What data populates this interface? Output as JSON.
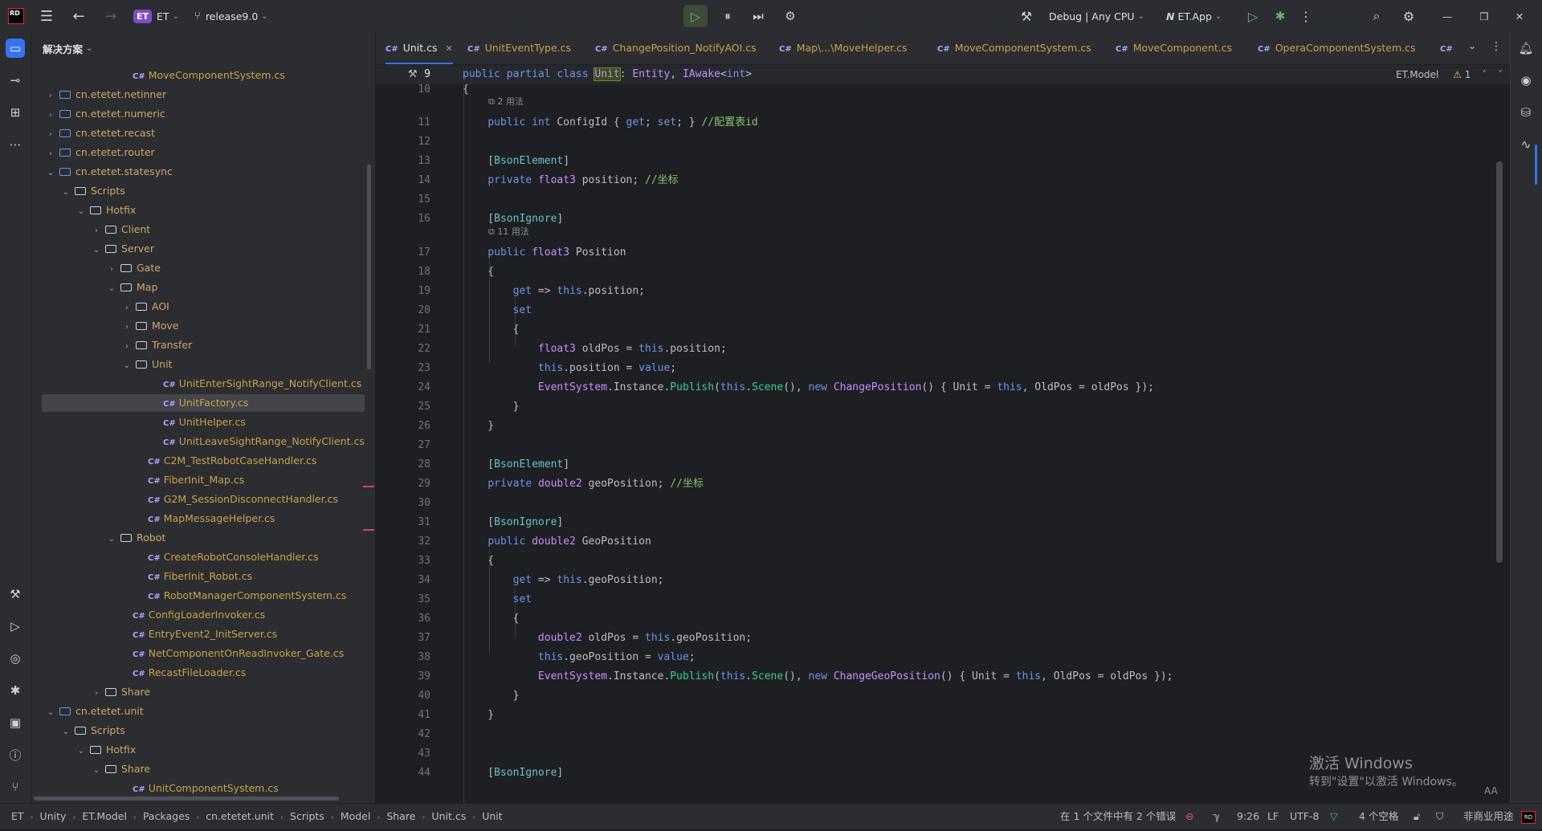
{
  "titlebar": {
    "app_logo": "RD",
    "project_badge": "ET",
    "project_name": "ET",
    "branch": "release9.0",
    "run_config": "Debug | Any CPU",
    "target": "ET.App"
  },
  "project_panel": {
    "header": "解决方案",
    "rows": [
      {
        "type": "file",
        "label": "MoveComponentSystem.cs",
        "indent": 8,
        "arrow": ""
      },
      {
        "type": "pkg",
        "label": "cn.etetet.netinner",
        "indent": 3,
        "arrow": "›"
      },
      {
        "type": "pkg",
        "label": "cn.etetet.numeric",
        "indent": 3,
        "arrow": "›"
      },
      {
        "type": "pkg",
        "label": "cn.etetet.recast",
        "indent": 3,
        "arrow": "›"
      },
      {
        "type": "pkg",
        "label": "cn.etetet.router",
        "indent": 3,
        "arrow": "›"
      },
      {
        "type": "pkg",
        "label": "cn.etetet.statesync",
        "indent": 3,
        "arrow": "⌄"
      },
      {
        "type": "folder",
        "label": "Scripts",
        "indent": 4,
        "arrow": "⌄"
      },
      {
        "type": "folder",
        "label": "Hotfix",
        "indent": 5,
        "arrow": "⌄"
      },
      {
        "type": "folder",
        "label": "Client",
        "indent": 6,
        "arrow": "›"
      },
      {
        "type": "folder",
        "label": "Server",
        "indent": 6,
        "arrow": "⌄"
      },
      {
        "type": "folder",
        "label": "Gate",
        "indent": 7,
        "arrow": "›"
      },
      {
        "type": "folder",
        "label": "Map",
        "indent": 7,
        "arrow": "⌄"
      },
      {
        "type": "folder",
        "label": "AOI",
        "indent": 8,
        "arrow": "›"
      },
      {
        "type": "folder",
        "label": "Move",
        "indent": 8,
        "arrow": "›"
      },
      {
        "type": "folder",
        "label": "Transfer",
        "indent": 8,
        "arrow": "›"
      },
      {
        "type": "folder",
        "label": "Unit",
        "indent": 8,
        "arrow": "⌄"
      },
      {
        "type": "file",
        "label": "UnitEnterSightRange_NotifyClient.cs",
        "indent": 10,
        "arrow": ""
      },
      {
        "type": "file",
        "label": "UnitFactory.cs",
        "indent": 10,
        "arrow": ""
      },
      {
        "type": "file",
        "label": "UnitHelper.cs",
        "indent": 10,
        "arrow": ""
      },
      {
        "type": "file",
        "label": "UnitLeaveSightRange_NotifyClient.cs",
        "indent": 10,
        "arrow": ""
      },
      {
        "type": "file",
        "label": "C2M_TestRobotCaseHandler.cs",
        "indent": 9,
        "arrow": ""
      },
      {
        "type": "file",
        "label": "FiberInit_Map.cs",
        "indent": 9,
        "arrow": ""
      },
      {
        "type": "file",
        "label": "G2M_SessionDisconnectHandler.cs",
        "indent": 9,
        "arrow": ""
      },
      {
        "type": "file",
        "label": "MapMessageHelper.cs",
        "indent": 9,
        "arrow": ""
      },
      {
        "type": "folder",
        "label": "Robot",
        "indent": 7,
        "arrow": "⌄"
      },
      {
        "type": "file",
        "label": "CreateRobotConsoleHandler.cs",
        "indent": 9,
        "arrow": ""
      },
      {
        "type": "file",
        "label": "FiberInit_Robot.cs",
        "indent": 9,
        "arrow": ""
      },
      {
        "type": "file",
        "label": "RobotManagerComponentSystem.cs",
        "indent": 9,
        "arrow": ""
      },
      {
        "type": "file",
        "label": "ConfigLoaderInvoker.cs",
        "indent": 8,
        "arrow": ""
      },
      {
        "type": "file",
        "label": "EntryEvent2_InitServer.cs",
        "indent": 8,
        "arrow": ""
      },
      {
        "type": "file",
        "label": "NetComponentOnReadInvoker_Gate.cs",
        "indent": 8,
        "arrow": ""
      },
      {
        "type": "file",
        "label": "RecastFileLoader.cs",
        "indent": 8,
        "arrow": ""
      },
      {
        "type": "folder",
        "label": "Share",
        "indent": 6,
        "arrow": "›"
      },
      {
        "type": "pkg",
        "label": "cn.etetet.unit",
        "indent": 3,
        "arrow": "⌄"
      },
      {
        "type": "folder",
        "label": "Scripts",
        "indent": 4,
        "arrow": "⌄"
      },
      {
        "type": "folder",
        "label": "Hotfix",
        "indent": 5,
        "arrow": "⌄"
      },
      {
        "type": "folder",
        "label": "Share",
        "indent": 6,
        "arrow": "⌄"
      },
      {
        "type": "file",
        "label": "UnitComponentSystem.cs",
        "indent": 8,
        "arrow": ""
      }
    ]
  },
  "tabs": [
    {
      "label": "Unit.cs",
      "active": true,
      "closable": true
    },
    {
      "label": "UnitEventType.cs",
      "active": false
    },
    {
      "label": "ChangePosition_NotifyAOI.cs",
      "active": false
    },
    {
      "label": "Map\\...\\MoveHelper.cs",
      "active": false
    },
    {
      "label": "MoveComponentSystem.cs",
      "active": false
    },
    {
      "label": "MoveComponent.cs",
      "active": false
    },
    {
      "label": "OperaComponentSystem.cs",
      "active": false
    },
    {
      "label": "C#",
      "active": false
    }
  ],
  "editor": {
    "right_info": "ET.Model",
    "warnings": "1",
    "lines": [
      {
        "n": "9",
        "html": "<span class=\"k\">public partial class</span> <span class=\"hl\">Unit</span>: <span class=\"cls\">Entity</span>, <span class=\"cls\">IAwake</span>&lt;<span class=\"k\">int</span>&gt;",
        "hint_before": ""
      },
      {
        "n": "10",
        "html": "{"
      },
      {
        "n": "11",
        "html": "    <span class=\"k\">public int</span> ConfigId { <span class=\"k\">get</span>; <span class=\"k\">set</span>; } <span class=\"c\">//配置表id</span>",
        "hint_before": "2 用法"
      },
      {
        "n": "12",
        "html": ""
      },
      {
        "n": "13",
        "html": "    [<span class=\"a\">BsonElement</span>]"
      },
      {
        "n": "14",
        "html": "    <span class=\"k\">private</span> <span class=\"cls\">float3</span> position; <span class=\"c\">//坐标</span>"
      },
      {
        "n": "15",
        "html": ""
      },
      {
        "n": "16",
        "html": "    [<span class=\"a\">BsonIgnore</span>]"
      },
      {
        "n": "17",
        "html": "    <span class=\"k\">public</span> <span class=\"cls\">float3</span> Position",
        "hint_before": "11 用法"
      },
      {
        "n": "18",
        "html": "    {"
      },
      {
        "n": "19",
        "html": "        <span class=\"k\">get</span> => <span class=\"k\">this</span>.position;"
      },
      {
        "n": "20",
        "html": "        <span class=\"k\">set</span>"
      },
      {
        "n": "21",
        "html": "        {"
      },
      {
        "n": "22",
        "html": "            <span class=\"cls\">float3</span> oldPos = <span class=\"k\">this</span>.position;"
      },
      {
        "n": "23",
        "html": "            <span class=\"k\">this</span>.position = <span class=\"k\">value</span>;"
      },
      {
        "n": "24",
        "html": "            <span class=\"cls\">EventSystem</span>.Instance.<span class=\"m\">Publish</span>(<span class=\"k\">this</span>.<span class=\"m\">Scene</span>(), <span class=\"k\">new</span> <span class=\"cls\">ChangePosition</span>() { Unit = <span class=\"k\">this</span>, OldPos = oldPos });"
      },
      {
        "n": "25",
        "html": "        }"
      },
      {
        "n": "26",
        "html": "    }"
      },
      {
        "n": "27",
        "html": ""
      },
      {
        "n": "28",
        "html": "    [<span class=\"a\">BsonElement</span>]"
      },
      {
        "n": "29",
        "html": "    <span class=\"k\">private</span> <span class=\"cls\">double2</span> geoPosition; <span class=\"c\">//坐标</span>"
      },
      {
        "n": "30",
        "html": ""
      },
      {
        "n": "31",
        "html": "    [<span class=\"a\">BsonIgnore</span>]"
      },
      {
        "n": "32",
        "html": "    <span class=\"k\">public</span> <span class=\"cls\">double2</span> GeoPosition"
      },
      {
        "n": "33",
        "html": "    {"
      },
      {
        "n": "34",
        "html": "        <span class=\"k\">get</span> => <span class=\"k\">this</span>.geoPosition;"
      },
      {
        "n": "35",
        "html": "        <span class=\"k\">set</span>"
      },
      {
        "n": "36",
        "html": "        {"
      },
      {
        "n": "37",
        "html": "            <span class=\"cls\">double2</span> oldPos = <span class=\"k\">this</span>.geoPosition;"
      },
      {
        "n": "38",
        "html": "            <span class=\"k\">this</span>.geoPosition = <span class=\"k\">value</span>;"
      },
      {
        "n": "39",
        "html": "            <span class=\"cls\">EventSystem</span>.Instance.<span class=\"m\">Publish</span>(<span class=\"k\">this</span>.<span class=\"m\">Scene</span>(), <span class=\"k\">new</span> <span class=\"cls\">ChangeGeoPosition</span>() { Unit = <span class=\"k\">this</span>, OldPos = oldPos });"
      },
      {
        "n": "40",
        "html": "        }"
      },
      {
        "n": "41",
        "html": "    }"
      },
      {
        "n": "42",
        "html": ""
      },
      {
        "n": "43",
        "html": ""
      },
      {
        "n": "44",
        "html": "    [<span class=\"a\">BsonIgnore</span>]"
      }
    ]
  },
  "watermark": {
    "line1": "激活 Windows",
    "line2": "转到\"设置\"以激活 Windows。"
  },
  "statusbar": {
    "breadcrumbs": [
      "ET",
      "Unity",
      "ET.Model",
      "Packages",
      "cn.etetet.unit",
      "Scripts",
      "Model",
      "Share",
      "Unit.cs",
      "Unit"
    ],
    "errors_text": "在 1 个文件中有 2 个错误",
    "position": "9:26",
    "line_sep": "LF",
    "encoding": "UTF-8",
    "indent": "4 个空格",
    "license": "非商业用途"
  }
}
